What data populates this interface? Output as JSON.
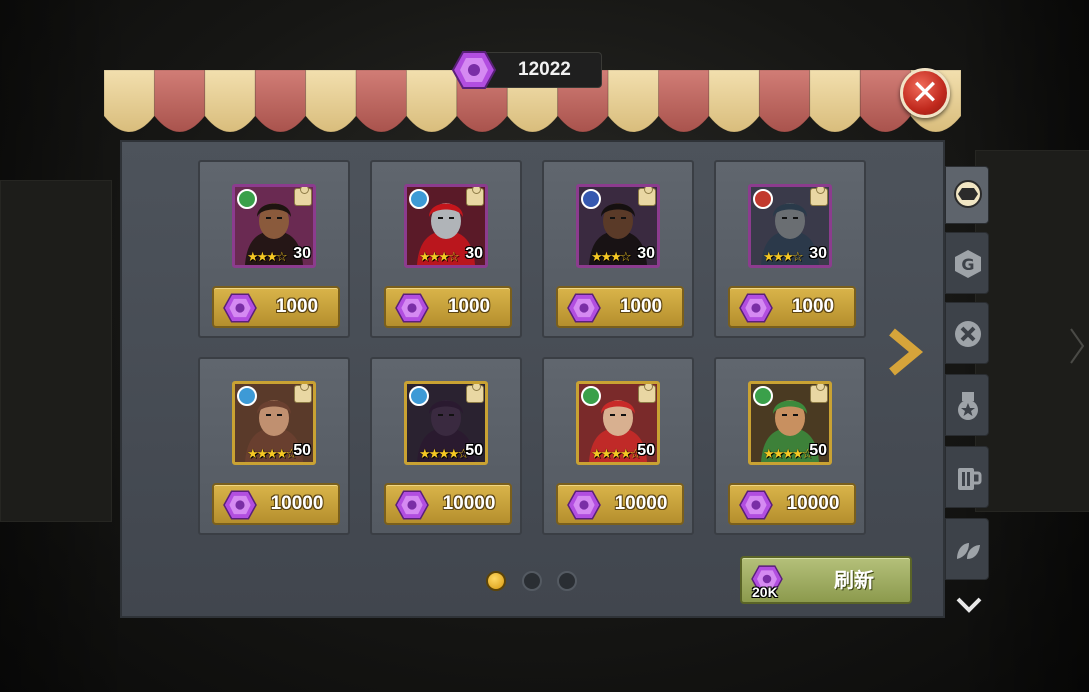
{
  "currency": {
    "balance": "12022",
    "icon": "purple-gem-icon",
    "color": "#b24ee0"
  },
  "close": {
    "icon": "close-icon",
    "glyph": "✕"
  },
  "shop": {
    "items": [
      {
        "level": "30",
        "stars": "★★★☆",
        "price": "1000",
        "faction": "green",
        "frame": "purple"
      },
      {
        "level": "30",
        "stars": "★★★☆",
        "price": "1000",
        "faction": "blue",
        "frame": "purple"
      },
      {
        "level": "30",
        "stars": "★★★☆",
        "price": "1000",
        "faction": "navy",
        "frame": "purple"
      },
      {
        "level": "30",
        "stars": "★★★☆",
        "price": "1000",
        "faction": "red",
        "frame": "purple"
      },
      {
        "level": "50",
        "stars": "★★★★☆",
        "price": "10000",
        "faction": "blue",
        "frame": "gold"
      },
      {
        "level": "50",
        "stars": "★★★★☆",
        "price": "10000",
        "faction": "blue",
        "frame": "gold"
      },
      {
        "level": "50",
        "stars": "★★★★☆",
        "price": "10000",
        "faction": "green",
        "frame": "gold"
      },
      {
        "level": "50",
        "stars": "★★★★☆",
        "price": "10000",
        "faction": "green",
        "frame": "gold"
      }
    ]
  },
  "pagination": {
    "current": 1,
    "total": 3
  },
  "refresh": {
    "cost": "20K",
    "label": "刷新"
  },
  "side_tabs": [
    {
      "icon": "purple-gem-icon",
      "active": true
    },
    {
      "icon": "g-coin-icon",
      "glyph": "G",
      "active": false
    },
    {
      "icon": "cross-medal-icon",
      "glyph": "✕",
      "active": false
    },
    {
      "icon": "star-badge-icon",
      "active": false
    },
    {
      "icon": "mug-icon",
      "active": false
    },
    {
      "icon": "leaf-icon",
      "active": false
    }
  ]
}
